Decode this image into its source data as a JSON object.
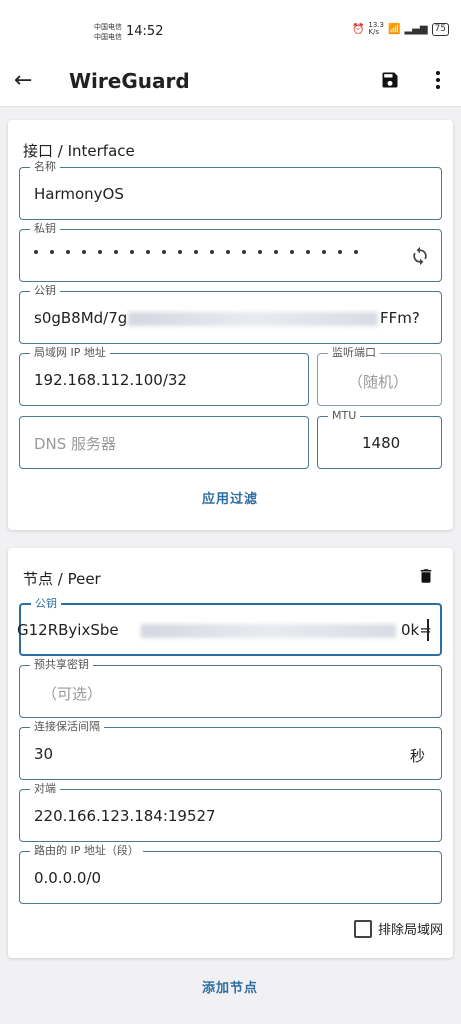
{
  "status_bar": {
    "carrier_1": "中国电信",
    "carrier_2": "中国电信",
    "time": "14:52",
    "speed": "13.3\nK/s",
    "battery": "75"
  },
  "app_bar": {
    "title": "WireGuard",
    "back_icon": "arrow-left-icon",
    "save_icon": "floppy-disk-icon",
    "more_icon": "more-vert-icon"
  },
  "interface": {
    "section_title": "接口 / Interface",
    "name": {
      "label": "名称",
      "value": "HarmonyOS"
    },
    "private_key": {
      "label": "私钥"
    },
    "public_key": {
      "label": "公钥",
      "value_start": "s0gB8Md/7g",
      "value_end": "FFm?"
    },
    "ip_address": {
      "label": "局域网 IP 地址",
      "value": "192.168.112.100/32"
    },
    "listen_port": {
      "label": "监听端口",
      "placeholder": "（随机）"
    },
    "dns": {
      "placeholder": "DNS 服务器"
    },
    "mtu": {
      "label": "MTU",
      "value": "1480"
    },
    "apply_filter": "应用过滤"
  },
  "peer": {
    "section_title": "节点 / Peer",
    "public_key": {
      "label": "公钥",
      "value_start": "G12RByixSbe",
      "value_end": "0k="
    },
    "preshared_key": {
      "label": "预共享密钥",
      "placeholder": "（可选）"
    },
    "keepalive": {
      "label": "连接保活间隔",
      "value": "30",
      "unit": "秒"
    },
    "endpoint": {
      "label": "对端",
      "value": "220.166.123.184:19527"
    },
    "allowed_ips": {
      "label": "路由的 IP 地址（段）",
      "value": "0.0.0.0/0"
    },
    "exclude_lan": "排除局域网"
  },
  "add_peer": "添加节点"
}
